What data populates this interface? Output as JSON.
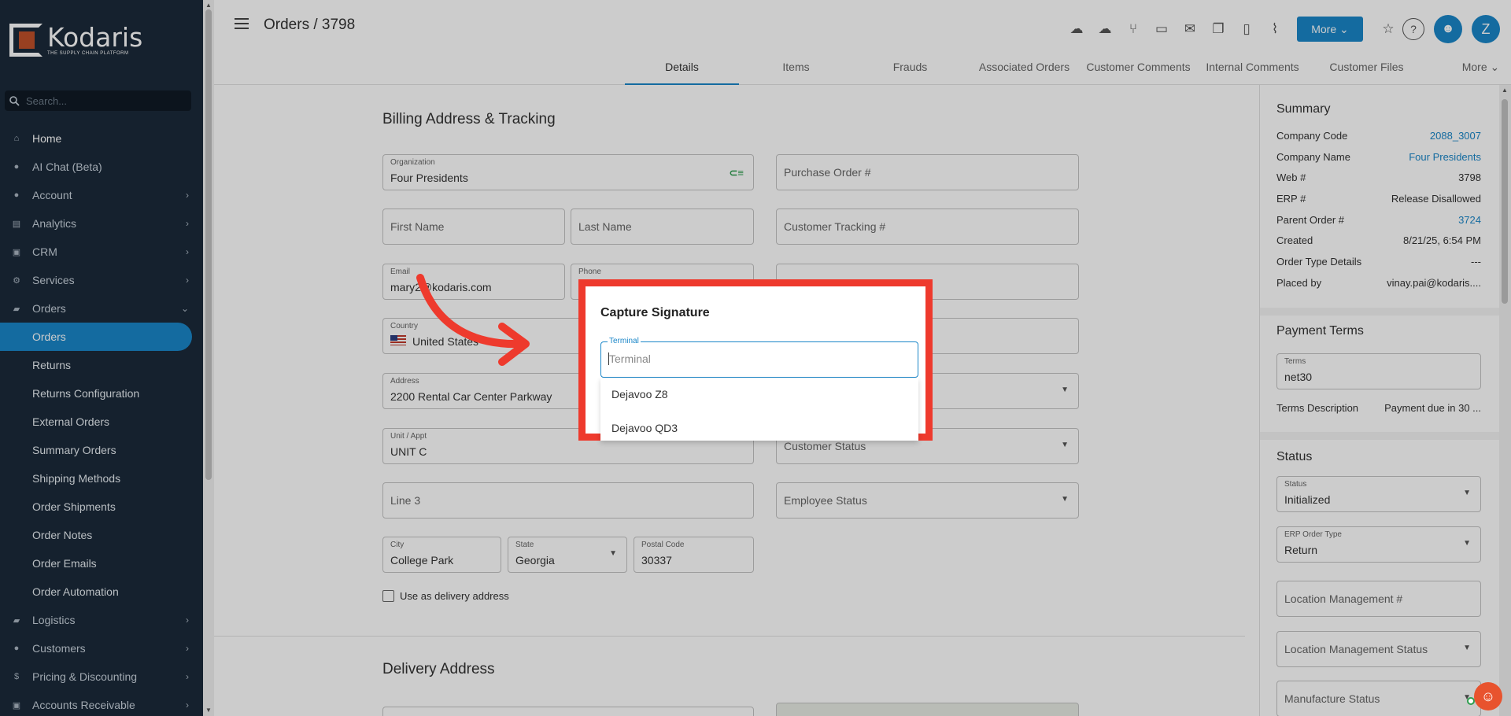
{
  "app": {
    "name": "Kodaris",
    "tagline": "THE SUPPLY CHAIN PLATFORM"
  },
  "search": {
    "placeholder": "Search..."
  },
  "nav": {
    "items": [
      {
        "label": "Home",
        "icon": "home-icon",
        "chevron": ""
      },
      {
        "label": "AI Chat (Beta)",
        "icon": "robot-icon",
        "chevron": ""
      },
      {
        "label": "Account",
        "icon": "person-icon",
        "chevron": "›"
      },
      {
        "label": "Analytics",
        "icon": "chart-icon",
        "chevron": "›"
      },
      {
        "label": "CRM",
        "icon": "crm-icon",
        "chevron": "›"
      },
      {
        "label": "Services",
        "icon": "services-icon",
        "chevron": "›"
      },
      {
        "label": "Orders",
        "icon": "truck-icon",
        "chevron": "⌄"
      }
    ],
    "order_sub": [
      "Orders",
      "Returns",
      "Returns Configuration",
      "External Orders",
      "Summary Orders",
      "Shipping Methods",
      "Order Shipments",
      "Order Notes",
      "Order Emails",
      "Order Automation"
    ],
    "bottom_items": [
      {
        "label": "Logistics",
        "icon": "logistics-icon",
        "chevron": "›"
      },
      {
        "label": "Customers",
        "icon": "people-icon",
        "chevron": "›"
      },
      {
        "label": "Pricing & Discounting",
        "icon": "dollar-icon",
        "chevron": "›"
      },
      {
        "label": "Accounts Receivable",
        "icon": "receivable-icon",
        "chevron": "›"
      }
    ]
  },
  "header": {
    "title": "Orders / 3798",
    "more_label": "More",
    "avatar_initial": "Z",
    "toolbar_icons": [
      "cloud-off-icon",
      "cloud-upload-icon",
      "fork-icon",
      "credit-card-icon",
      "mail-icon",
      "copy-icon",
      "file-add-icon",
      "attachment-icon"
    ]
  },
  "tabs": [
    "Details",
    "Items",
    "Frauds",
    "Associated Orders",
    "Customer Comments",
    "Internal Comments",
    "Customer Files",
    "More"
  ],
  "billing": {
    "title": "Billing Address & Tracking",
    "organization": {
      "label": "Organization",
      "value": "Four Presidents"
    },
    "purchase_order": {
      "placeholder": "Purchase Order #"
    },
    "first_name": {
      "placeholder": "First Name"
    },
    "last_name": {
      "placeholder": "Last Name"
    },
    "customer_tracking": {
      "placeholder": "Customer Tracking #"
    },
    "email": {
      "label": "Email",
      "value": "mary2@kodaris.com"
    },
    "phone": {
      "label": "Phone",
      "value": ""
    },
    "country": {
      "label": "Country",
      "value": "United States"
    },
    "address": {
      "label": "Address",
      "value": "2200 Rental Car Center Parkway"
    },
    "unit": {
      "label": "Unit / Appt",
      "value": "UNIT C"
    },
    "customer_status": {
      "placeholder": "Customer Status"
    },
    "line3": {
      "placeholder": "Line 3"
    },
    "employee_status": {
      "placeholder": "Employee Status"
    },
    "city": {
      "label": "City",
      "value": "College Park"
    },
    "state": {
      "label": "State",
      "value": "Georgia"
    },
    "postal": {
      "label": "Postal Code",
      "value": "30337"
    },
    "use_delivery": "Use as delivery address"
  },
  "delivery": {
    "title": "Delivery Address"
  },
  "summary": {
    "title": "Summary",
    "rows": [
      {
        "k": "Company Code",
        "v": "2088_3007",
        "link": true
      },
      {
        "k": "Company Name",
        "v": "Four Presidents",
        "link": true
      },
      {
        "k": "Web #",
        "v": "3798",
        "link": false
      },
      {
        "k": "ERP #",
        "v": "Release Disallowed",
        "link": false
      },
      {
        "k": "Parent Order #",
        "v": "3724",
        "link": true
      },
      {
        "k": "Created",
        "v": "8/21/25, 6:54 PM",
        "link": false
      },
      {
        "k": "Order Type Details",
        "v": "---",
        "link": false
      },
      {
        "k": "Placed by",
        "v": "vinay.pai@kodaris....",
        "link": false
      }
    ]
  },
  "payment": {
    "title": "Payment Terms",
    "terms_label": "Terms",
    "terms_value": "net30",
    "desc_key": "Terms Description",
    "desc_value": "Payment due in 30 ..."
  },
  "status": {
    "title": "Status",
    "status_label": "Status",
    "status_value": "Initialized",
    "erp_label": "ERP Order Type",
    "erp_value": "Return",
    "loc_mgmt": "Location Management #",
    "loc_status": "Location Management Status",
    "manufacture": "Manufacture Status"
  },
  "modal": {
    "title": "Capture Signature",
    "field_label": "Terminal",
    "field_placeholder": "Terminal",
    "options": [
      "Dejavoo Z8",
      "Dejavoo QD3"
    ]
  },
  "colors": {
    "accent": "#1a86c8",
    "sidebar": "#1b2a3a",
    "highlight": "#ee3a2d"
  }
}
